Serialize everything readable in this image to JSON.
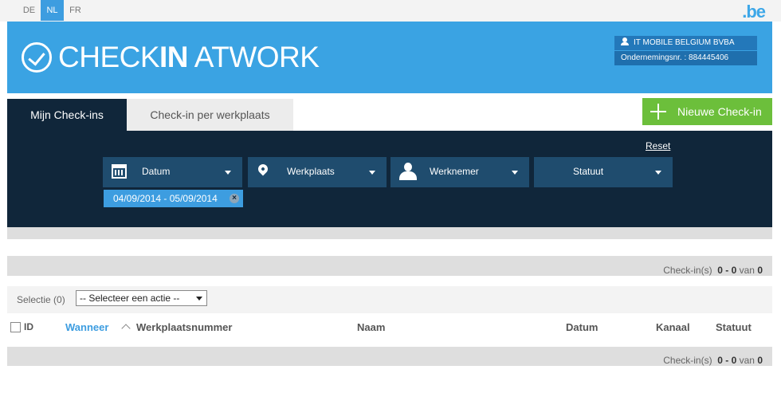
{
  "languages": [
    {
      "code": "DE",
      "active": false
    },
    {
      "code": "NL",
      "active": true
    },
    {
      "code": "FR",
      "active": false
    }
  ],
  "be_logo": ".be",
  "brand": {
    "part1": "CHECK",
    "part2": "IN",
    "part3": "AT",
    "part4": "WORK"
  },
  "company": {
    "name": "IT MOBILE BELGIUM BVBA",
    "number": "Ondernemingsnr. : 884445406"
  },
  "tabs": [
    {
      "label": "Mijn Check-ins",
      "active": true
    },
    {
      "label": "Check-in per werkplaats",
      "active": false
    }
  ],
  "new_checkin_label": "Nieuwe Check-in",
  "filters": {
    "reset_label": "Reset",
    "date_label": "Datum",
    "workplace_label": "Werkplaats",
    "employee_label": "Werknemer",
    "status_label": "Statuut",
    "active_chip": "04/09/2014 - 05/09/2014",
    "chip_remove": "×"
  },
  "counts": {
    "label": "Check-in(s)",
    "range": "0 - 0",
    "of_label": "van",
    "total": "0"
  },
  "selection": {
    "label": "Selectie (0)",
    "action_select": "-- Selecteer een actie --"
  },
  "table": {
    "columns": {
      "id": "ID",
      "when": "Wanneer",
      "workplace_number": "Werkplaatsnummer",
      "name": "Naam",
      "date": "Datum",
      "channel": "Kanaal",
      "status": "Statuut"
    }
  },
  "colors": {
    "header_blue": "#3aa3e3",
    "navy": "#10263a",
    "green": "#6cbf3b",
    "accent": "#3d9de0"
  }
}
